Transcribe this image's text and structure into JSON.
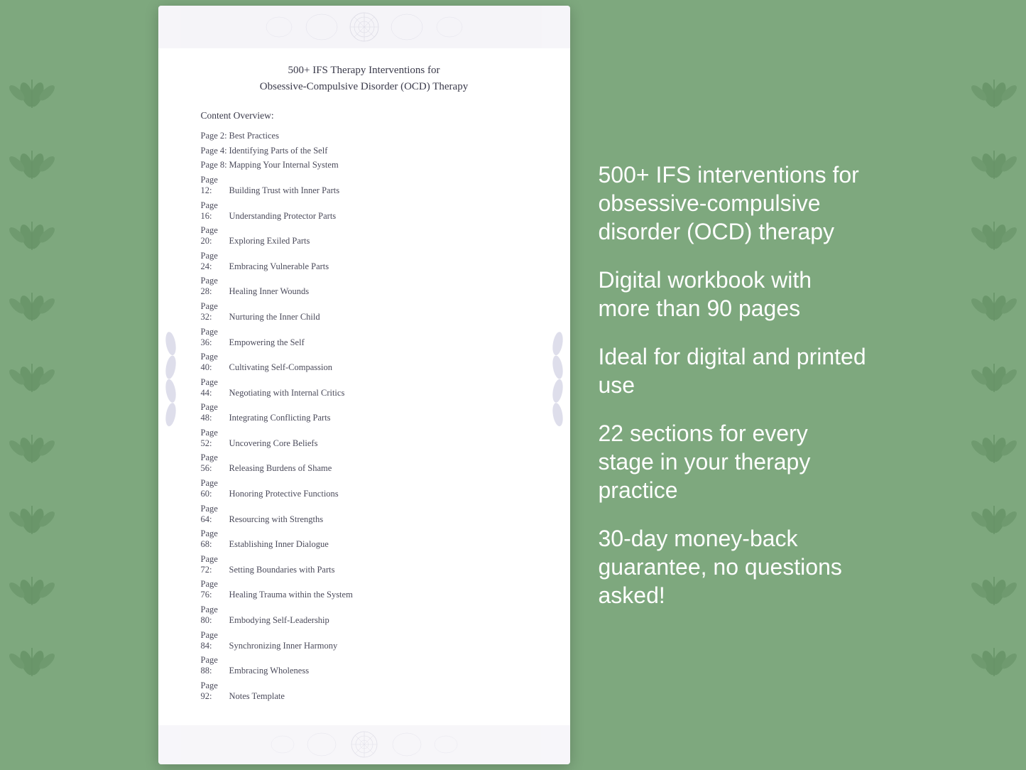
{
  "document": {
    "title_line1": "500+ IFS Therapy Interventions for",
    "title_line2": "Obsessive-Compulsive Disorder (OCD) Therapy",
    "section_label": "Content Overview:",
    "toc_items": [
      {
        "page": "Page  2:",
        "title": "Best Practices"
      },
      {
        "page": "Page  4:",
        "title": "Identifying Parts of the Self"
      },
      {
        "page": "Page  8:",
        "title": "Mapping Your Internal System"
      },
      {
        "page": "Page 12:",
        "title": "Building Trust with Inner Parts"
      },
      {
        "page": "Page 16:",
        "title": "Understanding Protector Parts"
      },
      {
        "page": "Page 20:",
        "title": "Exploring Exiled Parts"
      },
      {
        "page": "Page 24:",
        "title": "Embracing Vulnerable Parts"
      },
      {
        "page": "Page 28:",
        "title": "Healing Inner Wounds"
      },
      {
        "page": "Page 32:",
        "title": "Nurturing the Inner Child"
      },
      {
        "page": "Page 36:",
        "title": "Empowering the Self"
      },
      {
        "page": "Page 40:",
        "title": "Cultivating Self-Compassion"
      },
      {
        "page": "Page 44:",
        "title": "Negotiating with Internal Critics"
      },
      {
        "page": "Page 48:",
        "title": "Integrating Conflicting Parts"
      },
      {
        "page": "Page 52:",
        "title": "Uncovering Core Beliefs"
      },
      {
        "page": "Page 56:",
        "title": "Releasing Burdens of Shame"
      },
      {
        "page": "Page 60:",
        "title": "Honoring Protective Functions"
      },
      {
        "page": "Page 64:",
        "title": "Resourcing with Strengths"
      },
      {
        "page": "Page 68:",
        "title": "Establishing Inner Dialogue"
      },
      {
        "page": "Page 72:",
        "title": "Setting Boundaries with Parts"
      },
      {
        "page": "Page 76:",
        "title": "Healing Trauma within the System"
      },
      {
        "page": "Page 80:",
        "title": "Embodying Self-Leadership"
      },
      {
        "page": "Page 84:",
        "title": "Synchronizing Inner Harmony"
      },
      {
        "page": "Page 88:",
        "title": "Embracing Wholeness"
      },
      {
        "page": "Page 92:",
        "title": "Notes Template"
      }
    ]
  },
  "info_panel": {
    "bullet1": "500+ IFS interventions for obsessive-compulsive disorder (OCD) therapy",
    "bullet2": "Digital workbook with more than 90 pages",
    "bullet3": "Ideal for digital and printed use",
    "bullet4": "22 sections for every stage in your therapy practice",
    "bullet5": "30-day money-back guarantee, no questions asked!"
  }
}
